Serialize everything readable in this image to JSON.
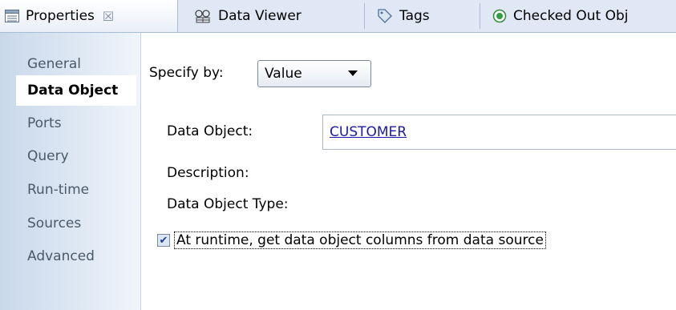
{
  "tabs": [
    {
      "label": "Properties",
      "icon": "properties-icon",
      "active": true,
      "closable": true
    },
    {
      "label": "Data Viewer",
      "icon": "data-viewer-icon",
      "active": false
    },
    {
      "label": "Tags",
      "icon": "tag-icon",
      "active": false
    },
    {
      "label": "Checked Out Obj",
      "icon": "checked-out-icon",
      "active": false
    }
  ],
  "close_glyph": "☒",
  "nav": {
    "items": [
      {
        "label": "General"
      },
      {
        "label": "Data Object",
        "selected": true
      },
      {
        "label": "Ports"
      },
      {
        "label": "Query"
      },
      {
        "label": "Run-time"
      },
      {
        "label": "Sources"
      },
      {
        "label": "Advanced"
      }
    ]
  },
  "main": {
    "specify_label": "Specify by:",
    "specify_value": "Value",
    "data_object_label": "Data Object:",
    "data_object_value": "CUSTOMER",
    "description_label": "Description:",
    "data_object_type_label": "Data Object Type:",
    "runtime_checkbox_label": "At runtime, get data object columns from data source",
    "runtime_checkbox_checked": true,
    "check_glyph": "✔"
  },
  "colors": {
    "tab_bar": "#dfe8f4",
    "link": "#1a1aa6",
    "nav_text": "#4b5968"
  }
}
